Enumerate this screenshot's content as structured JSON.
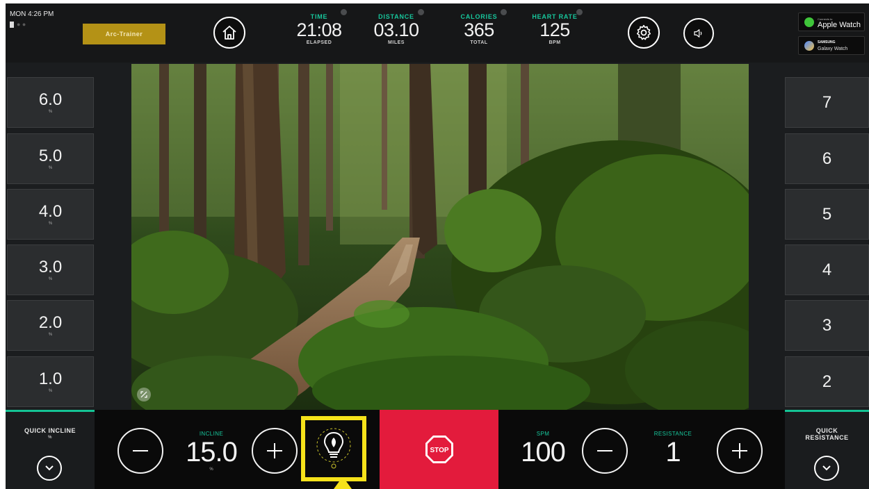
{
  "status": {
    "clock": "MON 4:26 PM"
  },
  "header": {
    "mode_button": "Arc-Trainer",
    "stats": [
      {
        "label": "TIME",
        "value": "21:08",
        "unit": "ELAPSED"
      },
      {
        "label": "DISTANCE",
        "value": "03.10",
        "unit": "MILES"
      },
      {
        "label": "CALORIES",
        "value": "365",
        "unit": "TOTAL"
      },
      {
        "label": "HEART RATE",
        "value": "125",
        "unit": "BPM"
      }
    ],
    "apple_watch": {
      "small": "Connects to",
      "name": "Apple Watch"
    },
    "galaxy_watch": {
      "brand": "SAMSUNG",
      "name": "Galaxy Watch"
    }
  },
  "incline_presets": [
    {
      "value": "6.0",
      "unit": "%"
    },
    {
      "value": "5.0",
      "unit": "%"
    },
    {
      "value": "4.0",
      "unit": "%"
    },
    {
      "value": "3.0",
      "unit": "%"
    },
    {
      "value": "2.0",
      "unit": "%"
    },
    {
      "value": "1.0",
      "unit": "%"
    }
  ],
  "resistance_presets": [
    "7",
    "6",
    "5",
    "4",
    "3",
    "2"
  ],
  "bottom": {
    "quick_incline": {
      "title": "QUICK INCLINE",
      "sub": "%"
    },
    "quick_resistance": {
      "title": "QUICK RESISTANCE"
    },
    "incline": {
      "label": "INCLINE",
      "value": "15.0",
      "unit": "%"
    },
    "spm": {
      "label": "SPM",
      "value": "100"
    },
    "resistance": {
      "label": "RESISTANCE",
      "value": "1"
    },
    "stop_label": "STOP"
  },
  "colors": {
    "accent": "#17c79c",
    "stop": "#e31b3c",
    "mode_button": "#b49216",
    "highlight": "#f6e21a"
  }
}
